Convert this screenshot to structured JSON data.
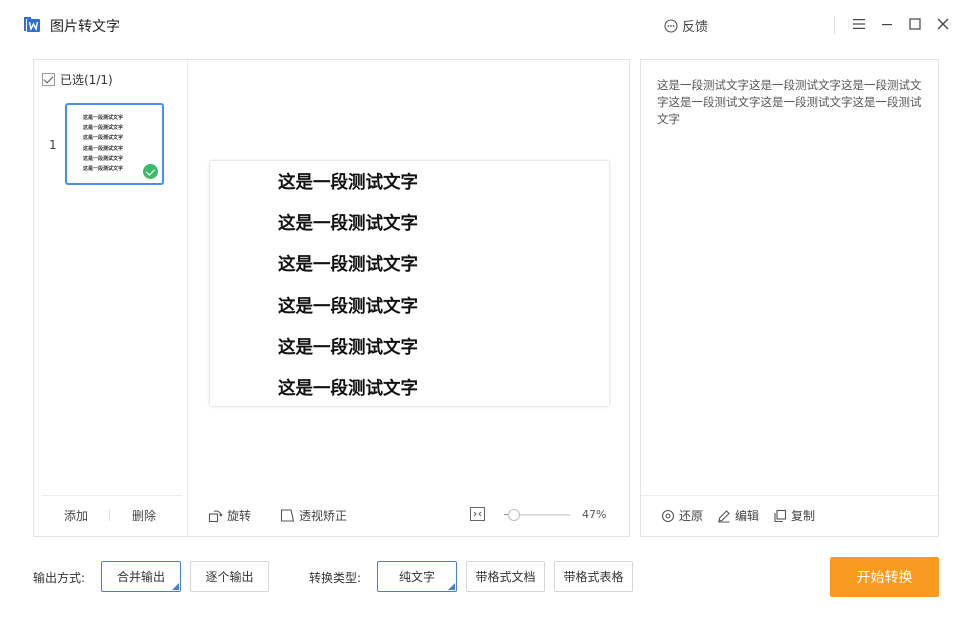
{
  "app": {
    "title": "图片转文字",
    "feedback_label": "反馈",
    "accent_color": "#4a90e2",
    "start_color": "#fa9b21"
  },
  "thumbs": {
    "select_all_label": "已选(1/1)",
    "items": [
      {
        "page_number": "1",
        "lines": [
          "这是一段测试文字",
          "这是一段测试文字",
          "这是一段测试文字",
          "这是一段测试文字",
          "这是一段测试文字",
          "这是一段测试文字"
        ],
        "selected": true
      }
    ],
    "add_label": "添加",
    "delete_label": "删除"
  },
  "preview": {
    "lines": [
      "这是一段测试文字",
      "这是一段测试文字",
      "这是一段测试文字",
      "这是一段测试文字",
      "这是一段测试文字",
      "这是一段测试文字"
    ],
    "rotate_label": "旋转",
    "perspective_label": "透视矫正",
    "zoom_percent": "47%",
    "zoom_value": 47
  },
  "result": {
    "text": "这是一段测试文字这是一段测试文字这是一段测试文字这是一段测试文字这是一段测试文字这是一段测试文字",
    "restore_label": "还原",
    "edit_label": "编辑",
    "copy_label": "复制"
  },
  "output": {
    "mode_label": "输出方式:",
    "options": [
      "合并输出",
      "逐个输出"
    ],
    "selected": "合并输出"
  },
  "convert": {
    "type_label": "转换类型:",
    "options": [
      "纯文字",
      "带格式文档",
      "带格式表格"
    ],
    "selected": "纯文字"
  },
  "start_label": "开始转换"
}
